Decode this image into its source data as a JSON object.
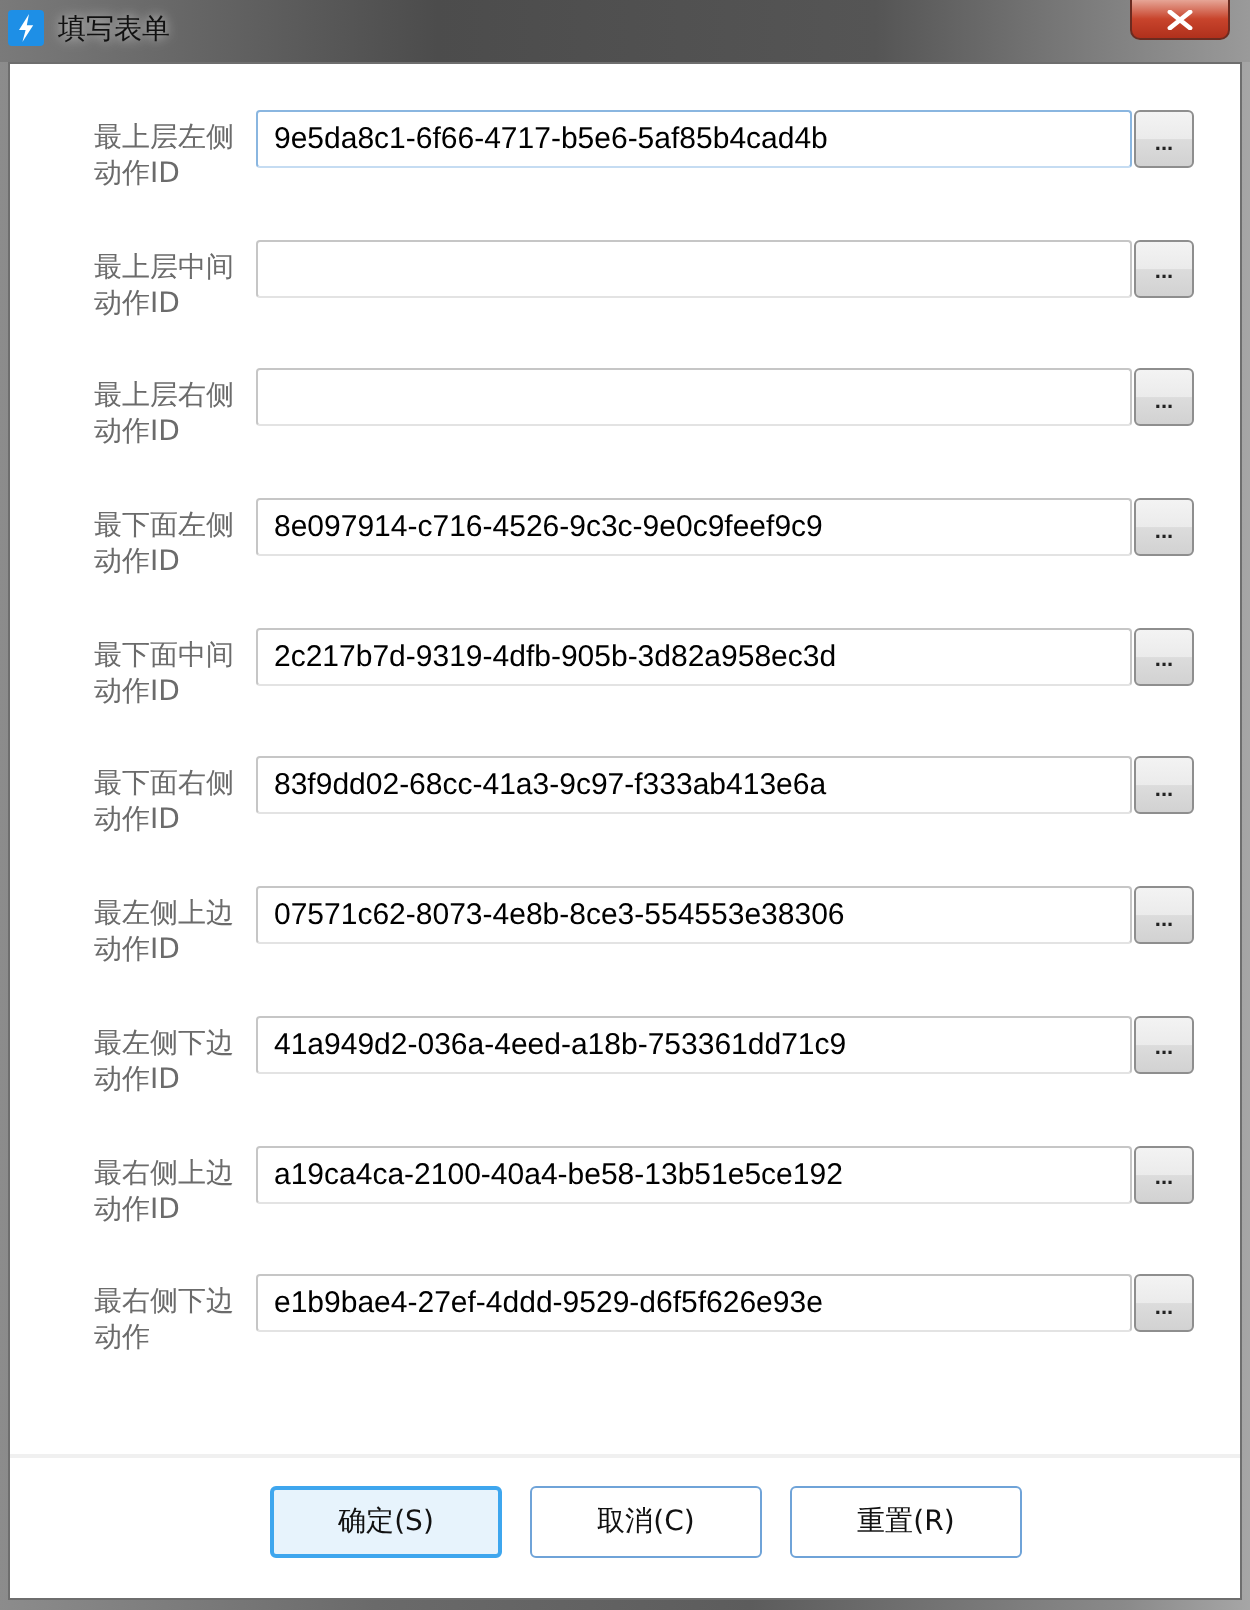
{
  "window": {
    "title": "填写表单"
  },
  "fields": [
    {
      "label": "最上层左侧动作ID",
      "value": "9e5da8c1-6f66-4717-b5e6-5af85b4cad4b",
      "focused": true,
      "button": "..."
    },
    {
      "label": "最上层中间动作ID",
      "focused": false,
      "button": "..."
    },
    {
      "label": "最上层右侧动作ID",
      "focused": false,
      "button": "..."
    },
    {
      "label": "最下面左侧动作ID",
      "value": "8e097914-c716-4526-9c3c-9e0c9feef9c9",
      "focused": false,
      "button": "..."
    },
    {
      "label": "最下面中间动作ID",
      "value": "2c217b7d-9319-4dfb-905b-3d82a958ec3d",
      "focused": false,
      "button": "..."
    },
    {
      "label": "最下面右侧动作ID",
      "value": "83f9dd02-68cc-41a3-9c97-f333ab413e6a",
      "focused": false,
      "button": "..."
    },
    {
      "label": "最左侧上边动作ID",
      "value": "07571c62-8073-4e8b-8ce3-554553e38306",
      "focused": false,
      "button": "..."
    },
    {
      "label": "最左侧下边动作ID",
      "value": "41a949d2-036a-4eed-a18b-753361dd71c9",
      "focused": false,
      "button": "..."
    },
    {
      "label": "最右侧上边动作ID",
      "value": "a19ca4ca-2100-40a4-be58-13b51e5ce192",
      "focused": false,
      "button": "..."
    },
    {
      "label": "最右侧下边动作",
      "value": "e1b9bae4-27ef-4ddd-9529-d6f5f626e93e",
      "focused": false,
      "button": "..."
    }
  ],
  "buttons": [
    {
      "label": "确定(S)",
      "default": true
    },
    {
      "label": "取消(C)",
      "default": false
    },
    {
      "label": "重置(R)",
      "default": false
    }
  ]
}
